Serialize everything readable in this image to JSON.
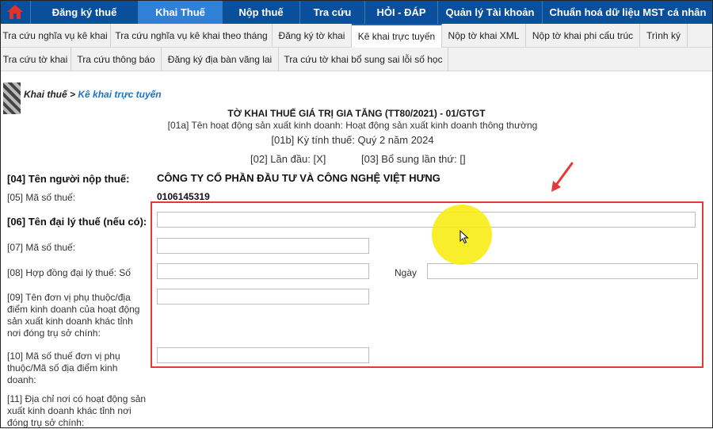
{
  "topnav": {
    "items": [
      {
        "label": "Đăng ký thuế",
        "active": false
      },
      {
        "label": "Khai Thuế",
        "active": true
      },
      {
        "label": "Nộp thuế",
        "active": false
      },
      {
        "label": "Tra cứu",
        "active": false
      },
      {
        "label": "HỎI - ĐÁP",
        "active": false
      },
      {
        "label": "Quản lý Tài khoản",
        "active": false
      },
      {
        "label": "Chuẩn hoá dữ liệu MST cá nhân",
        "active": false
      }
    ],
    "home_icon": "home-icon",
    "background": "#0a4f9c",
    "active_color": "#2f80d6"
  },
  "tabs_row1": [
    {
      "label": "Tra cứu nghĩa vụ kê khai",
      "active": false
    },
    {
      "label": "Tra cứu nghĩa vụ kê khai theo tháng",
      "active": false
    },
    {
      "label": "Đăng ký tờ khai",
      "active": false
    },
    {
      "label": "Kê khai trực tuyến",
      "active": true
    },
    {
      "label": "Nộp tờ khai XML",
      "active": false
    },
    {
      "label": "Nộp tờ khai phi cấu trúc",
      "active": false
    },
    {
      "label": "Trình ký",
      "active": false
    }
  ],
  "tabs_row2": [
    {
      "label": "Tra cứu tờ khai",
      "active": false
    },
    {
      "label": "Tra cứu thông báo",
      "active": false
    },
    {
      "label": "Đăng ký địa bàn vãng lai",
      "active": false
    },
    {
      "label": "Tra cứu tờ khai bổ sung sai lỗi số học",
      "active": false
    }
  ],
  "breadcrumb": {
    "parent": "Khai thuế >",
    "current": "Kê khai trực tuyến"
  },
  "form": {
    "title": "TỜ KHAI THUẾ GIÁ TRỊ GIA TĂNG (TT80/2021) - 01/GTGT",
    "activity": "[01a] Tên hoạt động sản xuất kinh doanh: Hoạt động sản xuất kinh doanh thông thường",
    "period": "[01b] Kỳ tính thuế: Quý 2 năm 2024",
    "first_time": "[02] Lần đầu: [X]",
    "supplement": "[03] Bổ sung lần thứ: []",
    "taxpayer_label": "[04] Tên người nộp thuế:",
    "taxpayer_value": "CÔNG TY CỔ PHẦN ĐẦU TƯ VÀ CÔNG NGHỆ VIỆT HƯNG",
    "tax_code_label": "[05] Mã số thuế:",
    "tax_code_value": "0106145319",
    "agent_label": "[06] Tên đại lý thuế (nếu có):",
    "agent_tax_code_label": "[07] Mã số thuế:",
    "contract_label": "[08] Hợp đồng đại lý thuế: Số",
    "contract_date_label": "Ngày",
    "dependent_unit_label": "[09] Tên đơn vị phụ thuộc/địa điểm kinh doanh của hoạt động sản xuất kinh doanh khác tỉnh nơi đóng trụ sở chính:",
    "dependent_tax_code_label": "[10] Mã số thuế đơn vị phụ thuộc/Mã số địa điểm kinh doanh:",
    "address_label": "[11] Địa chỉ nơi có hoạt động sản xuất kinh doanh khác tỉnh nơi đóng trụ sở chính:",
    "inputs": {
      "agent_name": "",
      "agent_tax_code": "",
      "contract_no": "",
      "contract_date": "",
      "dependent_unit": "",
      "dependent_tax_code": ""
    }
  },
  "annotation": {
    "box_color": "#e53935",
    "highlight_color": "#f7ec14"
  }
}
